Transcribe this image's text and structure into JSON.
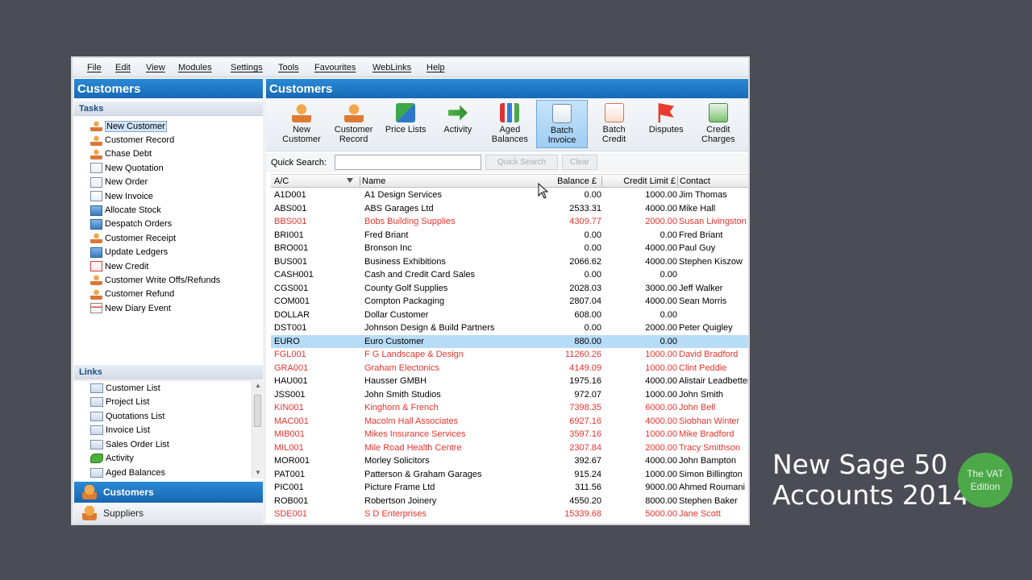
{
  "menu": [
    "File",
    "Edit",
    "View",
    "Modules",
    "Settings",
    "Tools",
    "Favourites",
    "WebLinks",
    "Help"
  ],
  "left": {
    "title": "Customers",
    "tasks_header": "Tasks",
    "tasks": [
      {
        "label": "New Customer",
        "icon": "person-icon",
        "selected": true
      },
      {
        "label": "Customer Record",
        "icon": "person-icon"
      },
      {
        "label": "Chase Debt",
        "icon": "person-icon"
      },
      {
        "label": "New Quotation",
        "icon": "document-icon"
      },
      {
        "label": "New Order",
        "icon": "document-icon"
      },
      {
        "label": "New Invoice",
        "icon": "document-icon"
      },
      {
        "label": "Allocate Stock",
        "icon": "box-icon"
      },
      {
        "label": "Despatch Orders",
        "icon": "box-icon"
      },
      {
        "label": "Customer Receipt",
        "icon": "person-icon"
      },
      {
        "label": "Update Ledgers",
        "icon": "box-icon"
      },
      {
        "label": "New Credit",
        "icon": "credit-note-icon"
      },
      {
        "label": "Customer Write Offs/Refunds",
        "icon": "person-icon"
      },
      {
        "label": "Customer Refund",
        "icon": "person-icon"
      },
      {
        "label": "New Diary Event",
        "icon": "calendar-icon"
      }
    ],
    "links_header": "Links",
    "links": [
      "Customer List",
      "Project List",
      "Quotations List",
      "Invoice List",
      "Sales Order List",
      "Activity",
      "Aged Balances"
    ],
    "nav": {
      "customers": "Customers",
      "suppliers": "Suppliers"
    }
  },
  "right": {
    "title": "Customers",
    "toolbar": [
      {
        "label": "New\nCustomer",
        "icon": "new-customer-icon"
      },
      {
        "label": "Customer\nRecord",
        "icon": "customer-record-icon"
      },
      {
        "label": "Price Lists",
        "icon": "price-lists-icon"
      },
      {
        "label": "Activity",
        "icon": "activity-icon"
      },
      {
        "label": "Aged\nBalances",
        "icon": "aged-balances-icon"
      },
      {
        "label": "Batch\nInvoice",
        "icon": "batch-invoice-icon",
        "active": true
      },
      {
        "label": "Batch\nCredit",
        "icon": "batch-credit-icon"
      },
      {
        "label": "Disputes",
        "icon": "disputes-icon"
      },
      {
        "label": "Credit\nCharges",
        "icon": "credit-charges-icon"
      }
    ],
    "quick_search_label": "Quick Search:",
    "quick_search_value": "",
    "quick_search_button": "Quick Search",
    "clear_button": "Clear",
    "columns": [
      "A/C",
      "Name",
      "Balance £",
      "Credit Limit £",
      "Contact"
    ],
    "rows": [
      {
        "ac": "A1D001",
        "name": "A1 Design Services",
        "balance": "0.00",
        "limit": "1000.00",
        "contact": "Jim Thomas"
      },
      {
        "ac": "ABS001",
        "name": "ABS Garages Ltd",
        "balance": "2533.31",
        "limit": "4000.00",
        "contact": "Mike Hall"
      },
      {
        "ac": "BBS001",
        "name": "Bobs Building Supplies",
        "balance": "4309.77",
        "limit": "2000.00",
        "contact": "Susan Livingston",
        "over_limit": true
      },
      {
        "ac": "BRI001",
        "name": "Fred Briant",
        "balance": "0.00",
        "limit": "0.00",
        "contact": "Fred Briant"
      },
      {
        "ac": "BRO001",
        "name": "Bronson Inc",
        "balance": "0.00",
        "limit": "4000.00",
        "contact": "Paul Guy"
      },
      {
        "ac": "BUS001",
        "name": "Business Exhibitions",
        "balance": "2066.62",
        "limit": "4000.00",
        "contact": "Stephen Kiszow"
      },
      {
        "ac": "CASH001",
        "name": "Cash and Credit Card Sales",
        "balance": "0.00",
        "limit": "0.00",
        "contact": ""
      },
      {
        "ac": "CGS001",
        "name": "County Golf Supplies",
        "balance": "2028.03",
        "limit": "3000.00",
        "contact": "Jeff Walker"
      },
      {
        "ac": "COM001",
        "name": "Compton Packaging",
        "balance": "2807.04",
        "limit": "4000.00",
        "contact": "Sean Morris"
      },
      {
        "ac": "DOLLAR",
        "name": "Dollar Customer",
        "balance": "608.00",
        "limit": "0.00",
        "contact": ""
      },
      {
        "ac": "DST001",
        "name": "Johnson Design & Build Partners",
        "balance": "0.00",
        "limit": "2000.00",
        "contact": "Peter Quigley"
      },
      {
        "ac": "EURO",
        "name": "Euro Customer",
        "balance": "880.00",
        "limit": "0.00",
        "contact": "",
        "selected": true
      },
      {
        "ac": "FGL001",
        "name": "F G Landscape & Design",
        "balance": "11260.26",
        "limit": "1000.00",
        "contact": "David Bradford",
        "over_limit": true
      },
      {
        "ac": "GRA001",
        "name": "Graham Electonics",
        "balance": "4149.09",
        "limit": "1000.00",
        "contact": "Clint Peddie",
        "over_limit": true
      },
      {
        "ac": "HAU001",
        "name": "Hausser GMBH",
        "balance": "1975.16",
        "limit": "4000.00",
        "contact": "Alistair Leadbetter"
      },
      {
        "ac": "JSS001",
        "name": "John Smith Studios",
        "balance": "972.07",
        "limit": "1000.00",
        "contact": "John Smith"
      },
      {
        "ac": "KIN001",
        "name": "Kinghorn & French",
        "balance": "7398.35",
        "limit": "6000.00",
        "contact": "John Bell",
        "over_limit": true
      },
      {
        "ac": "MAC001",
        "name": "Macolm Hall Associates",
        "balance": "6927.16",
        "limit": "4000.00",
        "contact": "Siobhan Winter",
        "over_limit": true
      },
      {
        "ac": "MIB001",
        "name": "Mikes Insurance Services",
        "balance": "3597.16",
        "limit": "1000.00",
        "contact": "Mike Bradford",
        "over_limit": true
      },
      {
        "ac": "MIL001",
        "name": "Mile Road Health Centre",
        "balance": "2307.84",
        "limit": "2000.00",
        "contact": "Tracy Smithson",
        "over_limit": true
      },
      {
        "ac": "MOR001",
        "name": "Morley Solicitors",
        "balance": "392.67",
        "limit": "4000.00",
        "contact": "John Bampton"
      },
      {
        "ac": "PAT001",
        "name": "Patterson & Graham Garages",
        "balance": "915.24",
        "limit": "1000.00",
        "contact": "Simon Billington"
      },
      {
        "ac": "PIC001",
        "name": "Picture Frame Ltd",
        "balance": "311.56",
        "limit": "9000.00",
        "contact": "Ahmed Roumani"
      },
      {
        "ac": "ROB001",
        "name": "Robertson Joinery",
        "balance": "4550.20",
        "limit": "8000.00",
        "contact": "Stephen Baker"
      },
      {
        "ac": "SDE001",
        "name": "S D Enterprises",
        "balance": "15339.68",
        "limit": "5000.00",
        "contact": "Jane Scott",
        "over_limit": true
      }
    ]
  },
  "branding": {
    "line1": "New Sage 50",
    "line2": "Accounts 2014",
    "badge_line1": "The VAT",
    "badge_line2": "Edition"
  },
  "colors": {
    "accent_blue": "#1769b6",
    "overlimit_red": "#e8332d",
    "selected_row": "#b7dcf7",
    "badge_green": "#4da84a"
  }
}
